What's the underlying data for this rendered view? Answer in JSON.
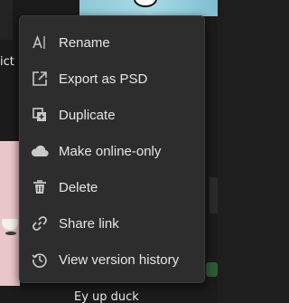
{
  "background": {
    "left_snippet": "ict",
    "bottom_card_title": "Ey up duck"
  },
  "menu": {
    "items": [
      {
        "label": "Rename",
        "icon": "text-cursor-icon"
      },
      {
        "label": "Export as PSD",
        "icon": "export-icon"
      },
      {
        "label": "Duplicate",
        "icon": "duplicate-icon"
      },
      {
        "label": "Make online-only",
        "icon": "cloud-icon"
      },
      {
        "label": "Delete",
        "icon": "trash-icon"
      },
      {
        "label": "Share link",
        "icon": "link-icon"
      },
      {
        "label": "View version history",
        "icon": "history-icon"
      }
    ]
  },
  "colors": {
    "menu_bg": "#2d2d2d",
    "menu_text": "#e6e6e6",
    "icon": "#c9c9c9",
    "page_bg": "#1b1b1b"
  }
}
